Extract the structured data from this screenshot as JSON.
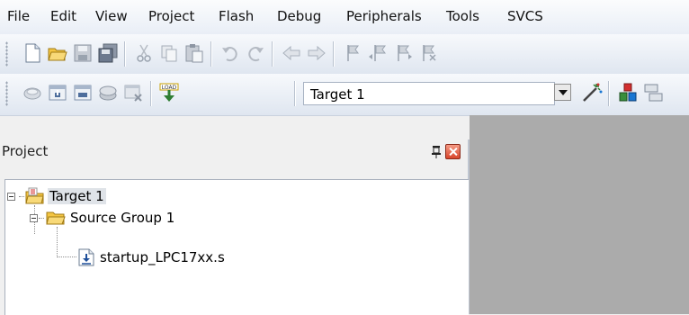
{
  "menu": [
    "File",
    "Edit",
    "View",
    "Project",
    "Flash",
    "Debug",
    "Peripherals",
    "Tools",
    "SVCS"
  ],
  "toolbar_file": {
    "buttons": [
      "new-file-icon",
      "open-folder-icon",
      "save-icon",
      "save-all-icon",
      "cut-icon",
      "copy-icon",
      "paste-icon",
      "undo-icon",
      "redo-icon",
      "nav-back-icon",
      "nav-forward-icon",
      "bookmark-icon",
      "bookmark-prev-icon",
      "bookmark-next-icon",
      "bookmark-clear-icon"
    ]
  },
  "toolbar_build": {
    "buttons": [
      "translate-icon",
      "build-icon",
      "rebuild-icon",
      "batch-build-icon",
      "stop-build-icon",
      "download-icon"
    ],
    "load_label": "LOAD",
    "target": "Target 1",
    "extra_buttons": [
      "options-wand-icon",
      "manage-components-icon",
      "manage-books-icon"
    ]
  },
  "project_panel": {
    "title": "Project",
    "tree": {
      "target": "Target 1",
      "group": "Source Group 1",
      "file": "startup_LPC17xx.s"
    }
  },
  "colors": {
    "editor_bg": "#ababab",
    "close_red": "#d8452b"
  }
}
